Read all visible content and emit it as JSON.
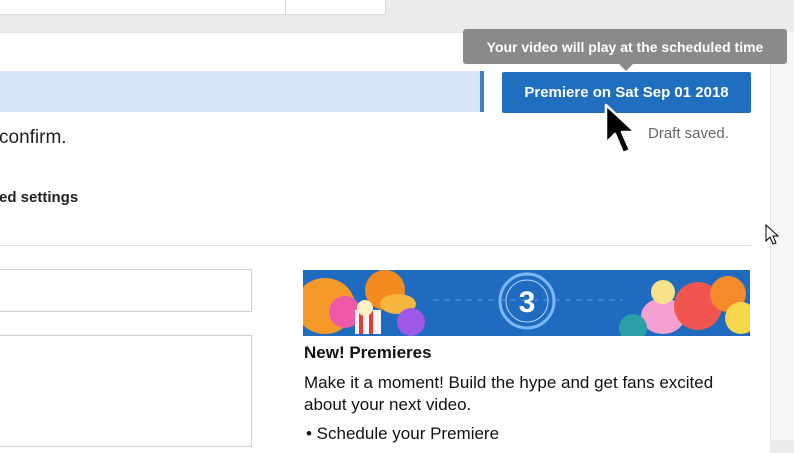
{
  "header": {
    "premiere_button_label": "Premiere on Sat Sep 01 2018",
    "tooltip_text": "Your video will play at the scheduled time",
    "draft_status": "Draft saved."
  },
  "main": {
    "confirm_text": "confirm.",
    "settings_text": "ed settings"
  },
  "promo": {
    "banner_countdown": "3",
    "title": "New! Premieres",
    "body": "Make it a moment! Build the hype and get fans excited about your next video.",
    "bullet": "• Schedule your Premiere"
  },
  "colors": {
    "accent_button": "#1f6ec0",
    "status_bar": "#d6e6f7",
    "tooltip": "#8a8a8a"
  }
}
